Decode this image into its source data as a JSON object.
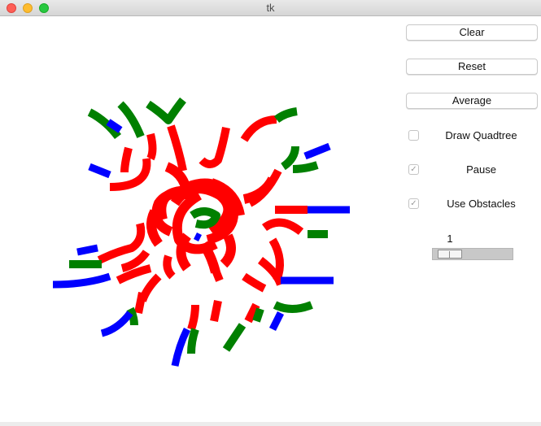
{
  "window": {
    "title": "tk"
  },
  "controls": {
    "clear_label": "Clear",
    "reset_label": "Reset",
    "average_label": "Average",
    "draw_quadtree": {
      "label": "Draw Quadtree",
      "checked": false
    },
    "pause": {
      "label": "Pause",
      "checked": true
    },
    "use_obstacles": {
      "label": "Use Obstacles",
      "checked": true
    },
    "speed_scale": {
      "value": "1",
      "min": 1,
      "max": 10
    }
  },
  "colors": {
    "red": "#ff0000",
    "green": "#008000",
    "blue": "#0000ff",
    "checkmark": "#9a9a9a"
  }
}
